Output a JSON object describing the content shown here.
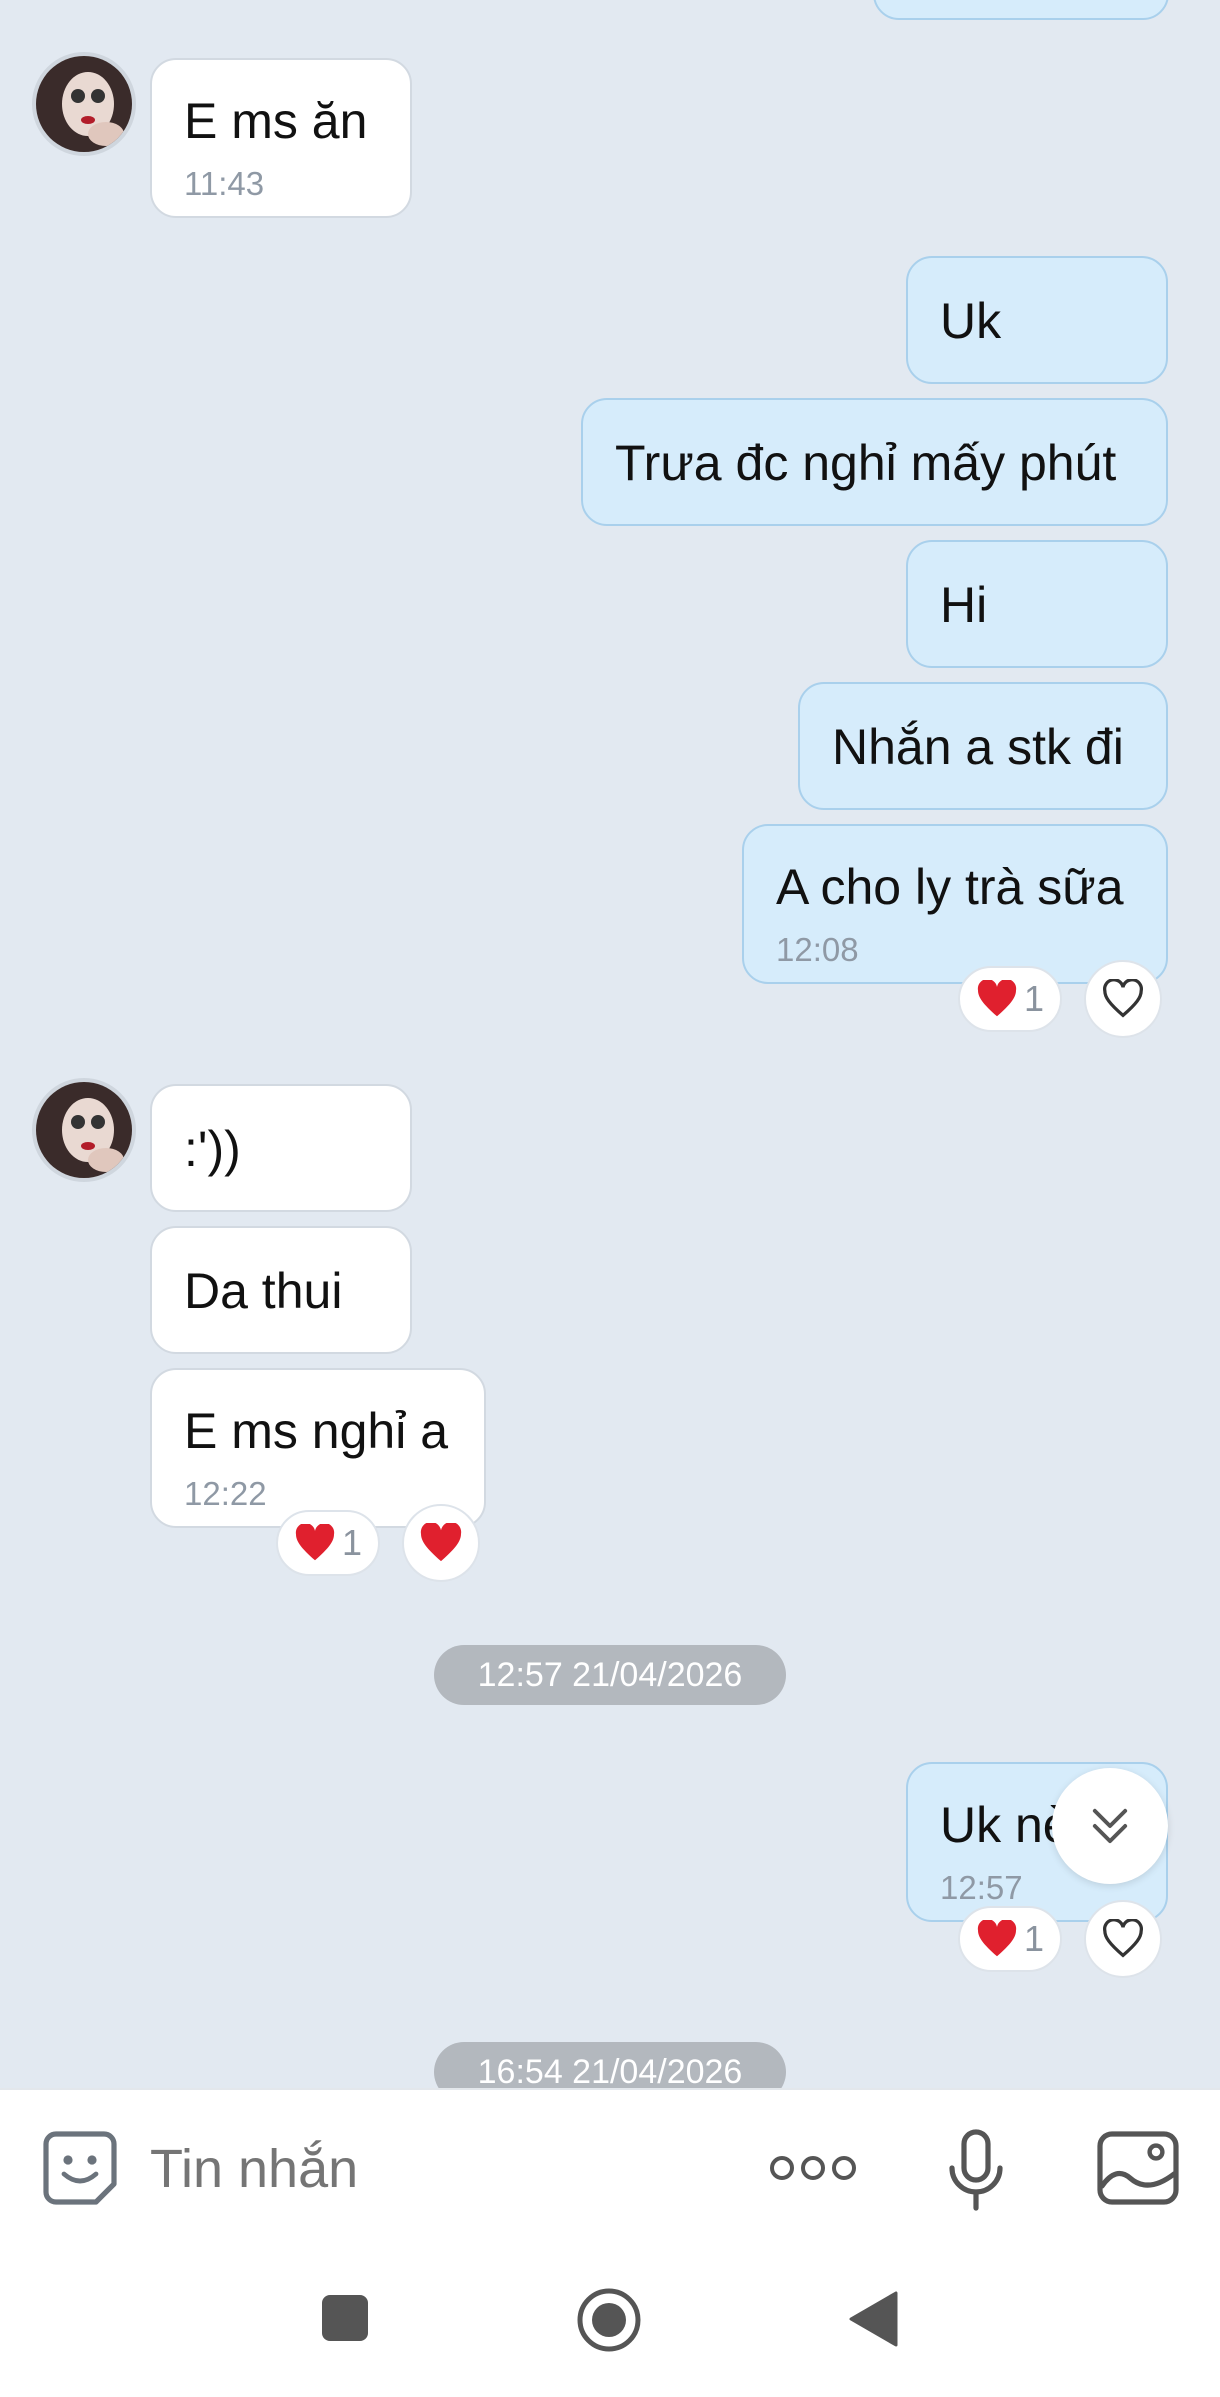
{
  "messages": [
    {
      "text": "E ms ăn",
      "time": "11:43"
    },
    {
      "text": "Uk"
    },
    {
      "text": "Trưa đc nghỉ mấy phút"
    },
    {
      "text": "Hi"
    },
    {
      "text": "Nhắn a stk đi"
    },
    {
      "text": "A cho ly trà sữa",
      "time": "12:08",
      "reaction_count": "1"
    },
    {
      "text": ":'))"
    },
    {
      "text": "Da thui"
    },
    {
      "text": "E ms nghỉ a",
      "time": "12:22",
      "reaction_count": "1"
    },
    {
      "text": "Uk nè",
      "time": "12:57",
      "reaction_count": "1"
    }
  ],
  "separators": [
    "12:57 21/04/2026",
    "16:54 21/04/2026"
  ],
  "composer": {
    "placeholder": "Tin nhắn"
  },
  "icons": {
    "avatar": "avatar",
    "reaction": "heart-icon",
    "like": "heart-outline-icon",
    "scroll": "double-chevron-down-icon",
    "sticker": "sticker-icon",
    "more": "more-dots-icon",
    "mic": "mic-icon",
    "image": "image-icon",
    "nav": [
      "square-icon",
      "circle-icon",
      "triangle-icon"
    ]
  },
  "colors": {
    "background": "#e2e9f1",
    "incoming_bubble": "#ffffff",
    "outgoing_bubble": "#d6ecfb",
    "heart": "#e0202e",
    "timestamp_pill": "#b3b8be"
  }
}
